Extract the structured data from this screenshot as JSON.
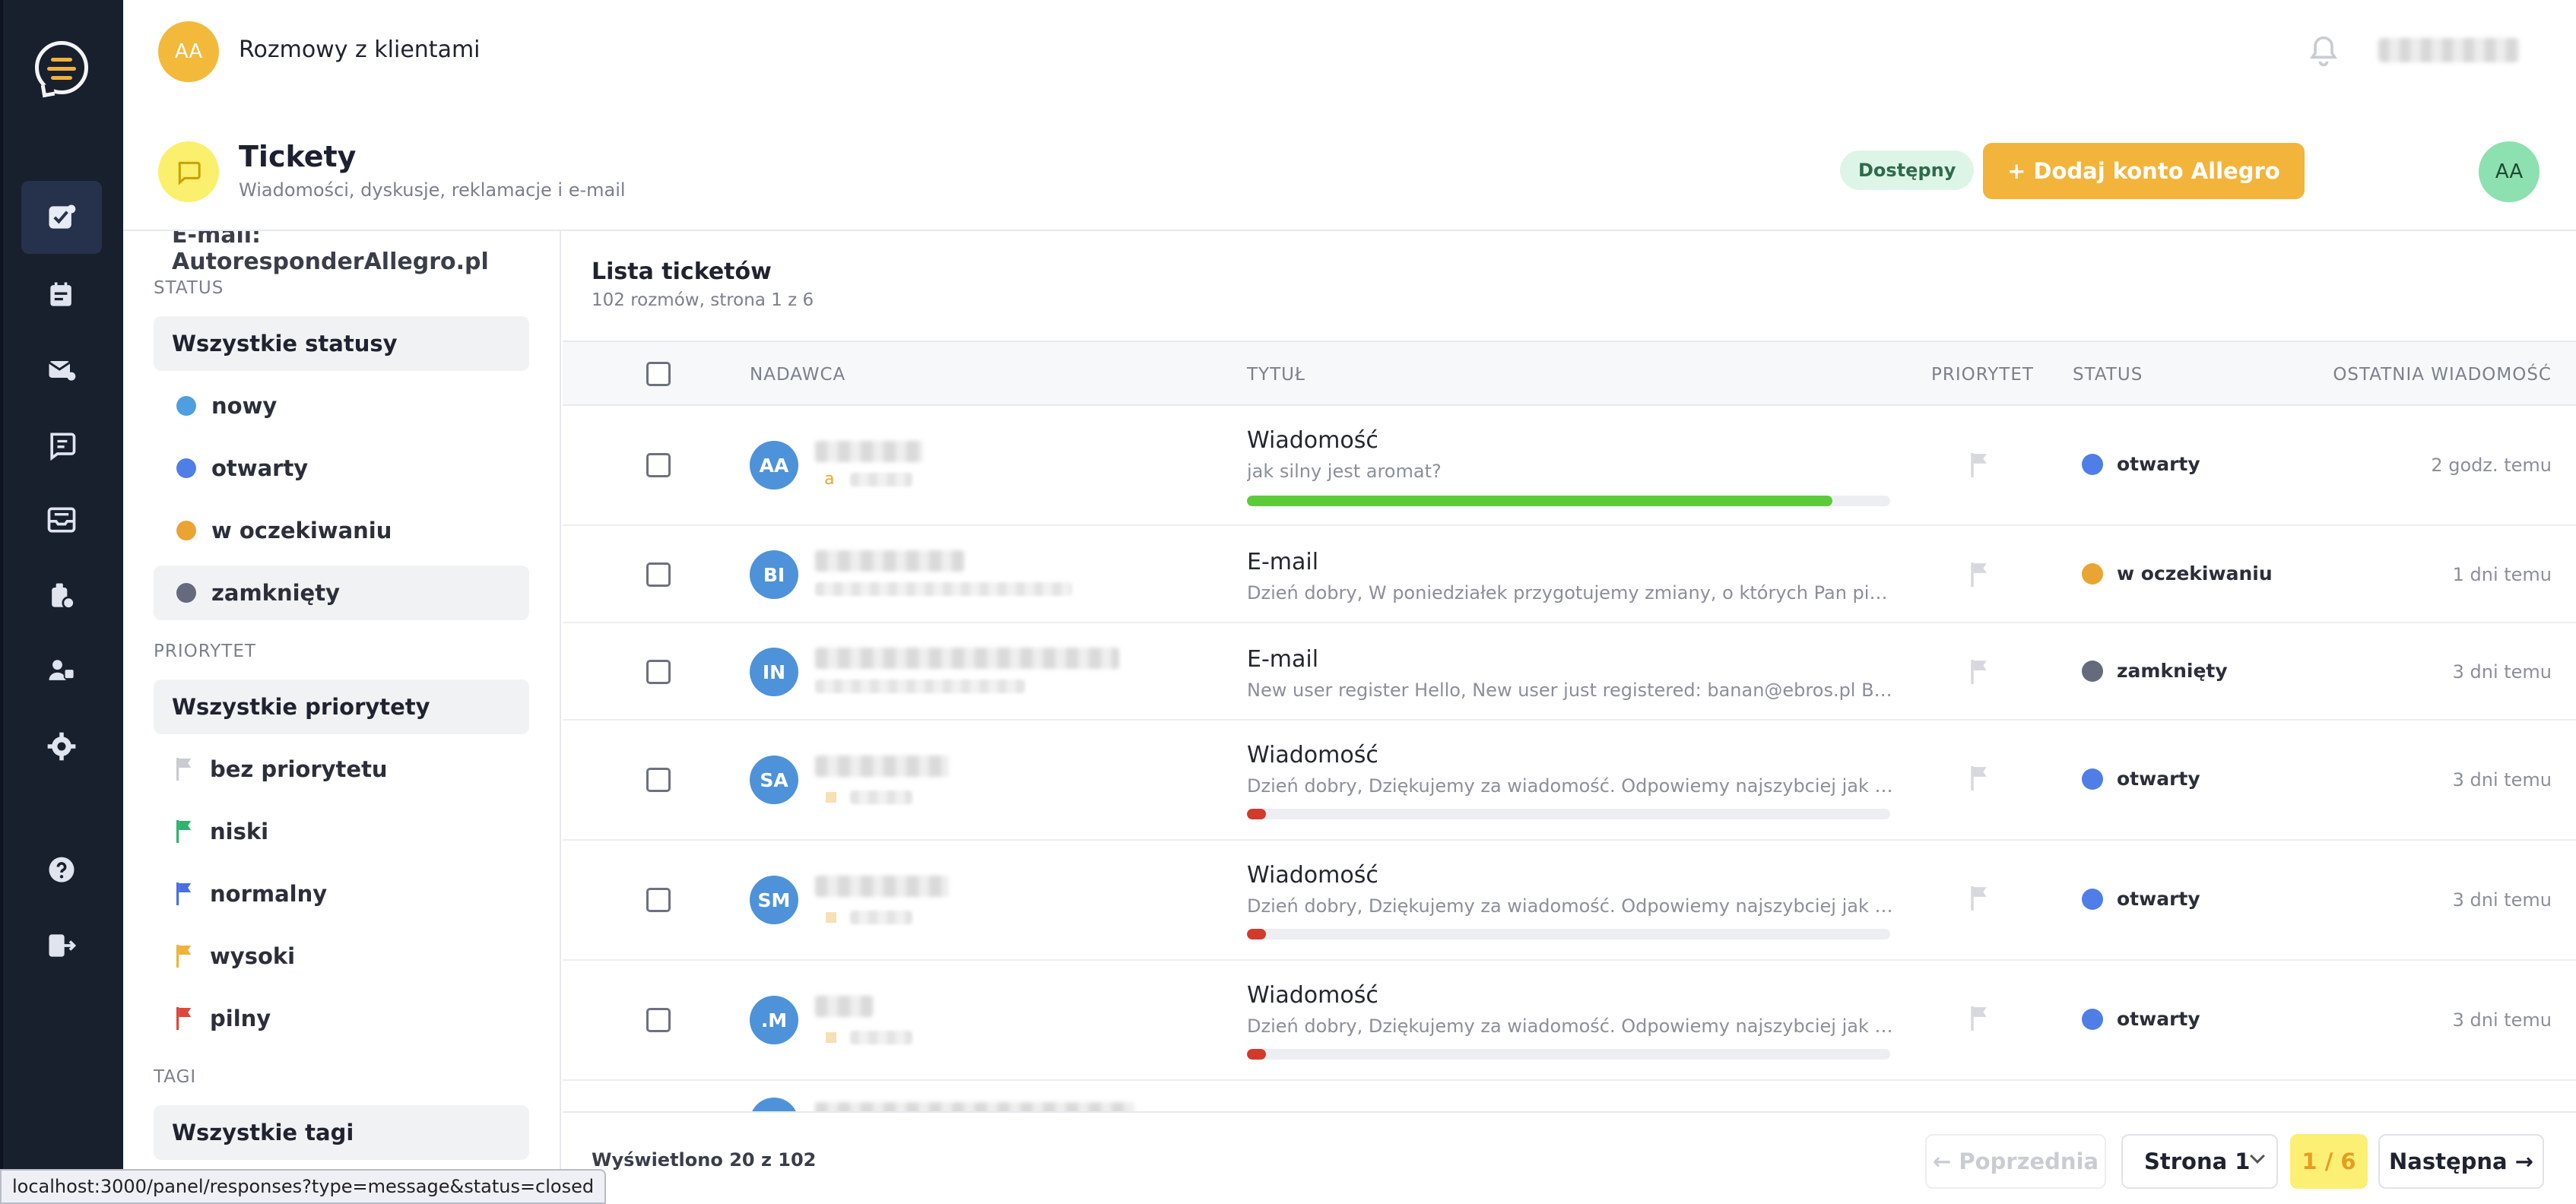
{
  "topbar": {
    "avatar": "AA",
    "title": "Rozmowy z klientami"
  },
  "pagehead": {
    "title": "Tickety",
    "subtitle": "Wiadomości, dyskusje, reklamacje i e-mail",
    "available": "Dostępny",
    "add_button": "+ Dodaj konto Allegro",
    "avatar": "AA"
  },
  "filters": {
    "cut_text": "E-mail: AutoresponderAllegro.pl",
    "status_label": "STATUS",
    "status_all": "Wszystkie statusy",
    "statuses": [
      {
        "label": "nowy",
        "color": "#4f9fe0"
      },
      {
        "label": "otwarty",
        "color": "#4f7ee6"
      },
      {
        "label": "w oczekiwaniu",
        "color": "#eaa433"
      },
      {
        "label": "zamknięty",
        "color": "#656b7c"
      }
    ],
    "priority_label": "PRIORYTET",
    "priority_all": "Wszystkie priorytety",
    "priorities": [
      {
        "label": "bez priorytetu",
        "color": "#c8cbd1"
      },
      {
        "label": "niski",
        "color": "#2fb36e"
      },
      {
        "label": "normalny",
        "color": "#4a6fe3"
      },
      {
        "label": "wysoki",
        "color": "#f0b23b"
      },
      {
        "label": "pilny",
        "color": "#e0463a"
      }
    ],
    "tags_label": "TAGI",
    "tags_all": "Wszystkie tagi"
  },
  "list": {
    "title": "Lista ticketów",
    "subtitle": "102 rozmów, strona 1 z 6",
    "columns": {
      "sender": "NADAWCA",
      "title": "TYTUŁ",
      "priority": "PRIORYTET",
      "status": "STATUS",
      "last": "OSTATNIA WIADOMOŚĆ"
    },
    "rows": [
      {
        "initials": "AA",
        "title": "Wiadomość",
        "preview": "jak silny jest aromat?",
        "progress": 0.91,
        "status": "otwarty",
        "status_color": "#4f7ee6",
        "time": "2 godz. temu",
        "mark": "a"
      },
      {
        "initials": "BI",
        "title": "E-mail",
        "preview": "Dzień dobry, W poniedziałek przygotujemy zmiany, o których Pan pisze i dzi...",
        "status": "w oczekiwaniu",
        "status_color": "#eaa433",
        "time": "1 dni temu"
      },
      {
        "initials": "IN",
        "title": "E-mail",
        "preview": "New user register Hello, New user just registered: banan@ebros.pl Best reg...",
        "status": "zamknięty",
        "status_color": "#656b7c",
        "time": "3 dni temu"
      },
      {
        "initials": "SA",
        "title": "Wiadomość",
        "preview": "Dzień dobry, Dziękujemy za wiadomość. Odpowiemy najszybciej jak to moż...",
        "progress": 0.03,
        "status": "otwarty",
        "status_color": "#4f7ee6",
        "time": "3 dni temu"
      },
      {
        "initials": "SM",
        "title": "Wiadomość",
        "preview": "Dzień dobry, Dziękujemy za wiadomość. Odpowiemy najszybciej jak to moż...",
        "progress": 0.03,
        "status": "otwarty",
        "status_color": "#4f7ee6",
        "time": "3 dni temu"
      },
      {
        "initials": ".M",
        "title": "Wiadomość",
        "preview": "Dzień dobry, Dziękujemy za wiadomość. Odpowiemy najszybciej jak to moż...",
        "progress": 0.03,
        "status": "otwarty",
        "status_color": "#4f7ee6",
        "time": "3 dni temu"
      }
    ]
  },
  "footer": {
    "shown": "Wyświetlono 20 z 102",
    "prev": "← Poprzednia",
    "page_select": "Strona 1",
    "pager": "1 / 6",
    "next": "Następna →"
  },
  "statusbar": {
    "url": "localhost:3000/panel/responses?type=message&status=closed"
  },
  "colors": {
    "accent": "#f3b43b",
    "progress_green": "#5ccb3a",
    "progress_red": "#d23a2a"
  }
}
